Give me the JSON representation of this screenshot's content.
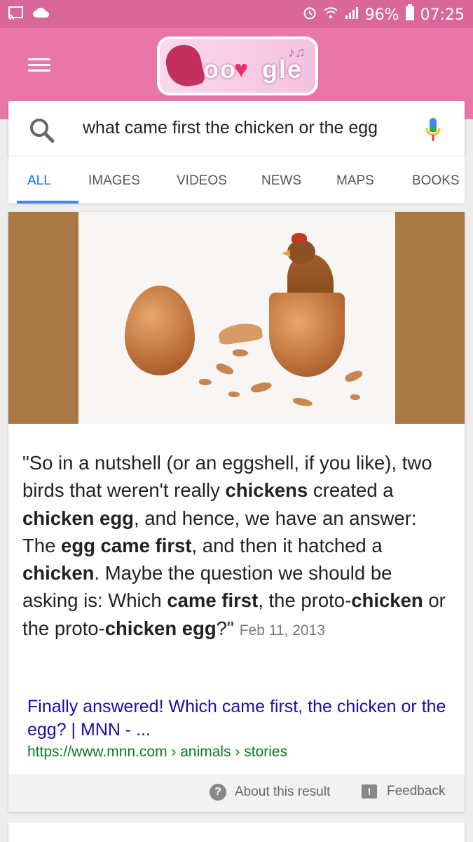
{
  "status_bar": {
    "battery": "96%",
    "time": "07:25",
    "icons": [
      "cast-icon",
      "cloud-icon",
      "alarm-icon",
      "wifi-icon",
      "signal-icon",
      "battery-icon"
    ]
  },
  "header": {
    "doodle_alt": "Google Doodle",
    "accent_color": "#ea76a8"
  },
  "search": {
    "query": "what came first the chicken or the egg"
  },
  "tabs": [
    {
      "label": "ALL",
      "active": true
    },
    {
      "label": "IMAGES"
    },
    {
      "label": "VIDEOS"
    },
    {
      "label": "NEWS"
    },
    {
      "label": "MAPS"
    },
    {
      "label": "BOOKS"
    }
  ],
  "result": {
    "quote_segments": [
      {
        "t": "\"So in a nutshell (or an eggshell, if you like), two birds that weren't really ",
        "b": false
      },
      {
        "t": "chickens",
        "b": true
      },
      {
        "t": " created a ",
        "b": false
      },
      {
        "t": "chicken egg",
        "b": true
      },
      {
        "t": ", and hence, we have an answer: The ",
        "b": false
      },
      {
        "t": "egg came first",
        "b": true
      },
      {
        "t": ", and then it hatched a ",
        "b": false
      },
      {
        "t": "chicken",
        "b": true
      },
      {
        "t": ". Maybe the question we should be asking is: Which ",
        "b": false
      },
      {
        "t": "came first",
        "b": true
      },
      {
        "t": ", the proto-",
        "b": false
      },
      {
        "t": "chicken",
        "b": true
      },
      {
        "t": " or the proto-",
        "b": false
      },
      {
        "t": "chicken egg",
        "b": true
      },
      {
        "t": "?\"",
        "b": false
      }
    ],
    "date": "Feb 11, 2013",
    "title": "Finally answered! Which came first, the chicken or the egg? | MNN - ...",
    "url": "https://www.mnn.com › animals › stories",
    "link_color": "#1a0dab",
    "url_color": "#0b7a1f"
  },
  "footer": {
    "about_label": "About this result",
    "feedback_label": "Feedback"
  }
}
